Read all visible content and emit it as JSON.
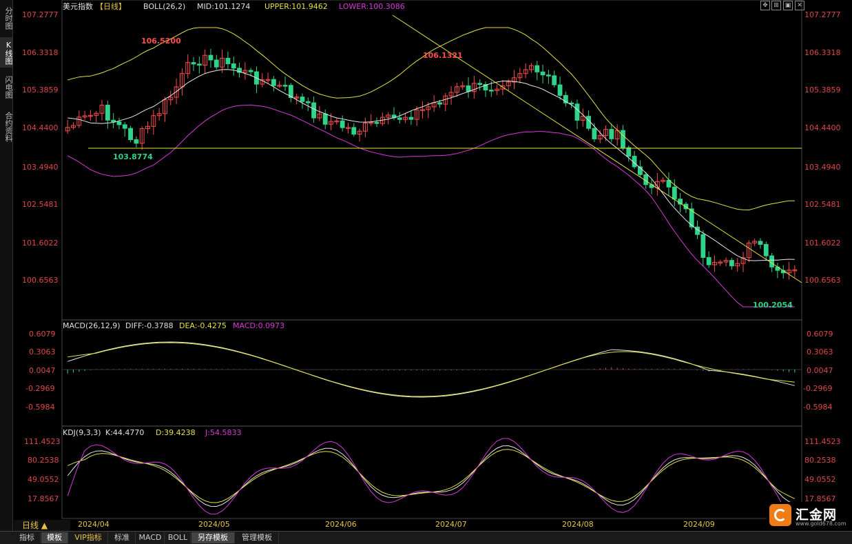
{
  "left_tabs": [
    "分时图",
    "K线图",
    "闪电图",
    "合约资料"
  ],
  "main": {
    "symbol": "美元指数",
    "period_tag": "【日线】",
    "boll_label": "BOLL(26,2)",
    "mid_label": "MID:101.1274",
    "upper_label": "UPPER:101.9462",
    "lower_label": "LOWER:100.3086",
    "price_labels": [
      "107.2777",
      "106.3318",
      "105.3859",
      "104.4400",
      "103.4940",
      "102.5481",
      "101.6022",
      "100.6563"
    ],
    "annotations": {
      "high1": "106.5200",
      "high2": "106.1321",
      "low1": "103.8774",
      "low2": "100.2054"
    }
  },
  "macd": {
    "label": "MACD(26,12,9)",
    "diff_label": "DIFF:-0.3788",
    "dea_label": "DEA:-0.4275",
    "macd_label": "MACD:0.0973",
    "axis_labels": [
      "0.6079",
      "0.3063",
      "0.0047",
      "-0.2969",
      "-0.5984"
    ]
  },
  "kdj": {
    "label": "KDJ(9,3,3)",
    "k_label": "K:44.4770",
    "d_label": "D:39.4238",
    "j_label": "J:54.5833",
    "axis_labels": [
      "111.4523",
      "80.2538",
      "49.0552",
      "17.8567"
    ]
  },
  "dates": [
    "2024/04",
    "2024/05",
    "2024/06",
    "2024/07",
    "2024/08",
    "2024/09"
  ],
  "period_button": "日线 ▲",
  "bottom_tabs": [
    "指标",
    "模板",
    "VIP指标",
    "标准",
    "MACD",
    "BOLL",
    "另存模板",
    "管理模板"
  ],
  "logo": {
    "name": "汇金网",
    "url": "www.gold678.com"
  },
  "top_icons": [
    "move-icon",
    "zoom-icon",
    "restore-icon",
    "close-icon"
  ],
  "colors": {
    "up": "#ff4d4d",
    "down": "#2fd48a",
    "mid_line": "#e8e8e8",
    "upper_line": "#e4e23f",
    "lower_line": "#d93ad9",
    "price_axis": "#e04848",
    "annotation_high": "#ff4d4d",
    "annotation_low": "#2fd48a"
  }
}
